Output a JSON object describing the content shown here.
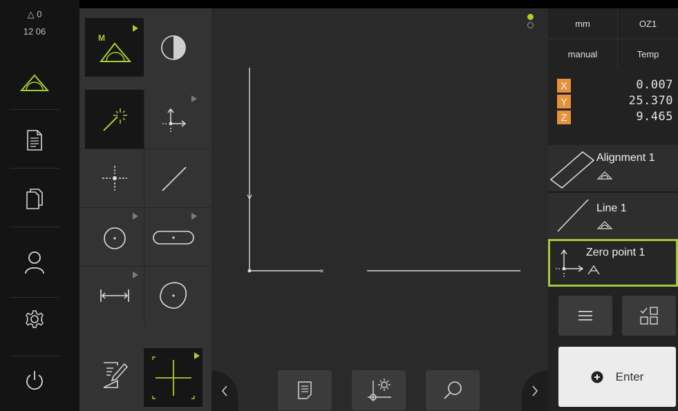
{
  "status": {
    "warnings": "△ 0",
    "time": "12 06"
  },
  "nav": {
    "items": [
      {
        "name": "measure-icon"
      },
      {
        "name": "measurement-report-icon"
      },
      {
        "name": "file-management-icon"
      },
      {
        "name": "user-login-icon"
      },
      {
        "name": "settings-icon"
      },
      {
        "name": "power-icon"
      }
    ]
  },
  "palette": {
    "tools": [
      "manual-measurement-icon",
      "contrast-icon",
      "measure-magic-icon",
      "zero-point-icon",
      "point-icon",
      "line-icon",
      "circle-icon",
      "slot-icon",
      "distance-icon",
      "blob-icon",
      "annotation-icon",
      "crosshair-icon"
    ]
  },
  "canvas": {
    "buttons": [
      "report-icon",
      "view-settings-icon",
      "zoom-icon"
    ],
    "x_axis_marker": "×"
  },
  "right": {
    "unit": "mm",
    "coord_system": "OZ1",
    "mode": "manual",
    "temp": "Temp",
    "coordinates": [
      {
        "axis": "X",
        "value": "0.007"
      },
      {
        "axis": "Y",
        "value": "25.370"
      },
      {
        "axis": "Z",
        "value": "9.465"
      }
    ],
    "features": [
      {
        "name": "Alignment 1"
      },
      {
        "name": "Line 1"
      },
      {
        "name": "Zero point 1"
      }
    ],
    "enter_label": "Enter"
  },
  "colors": {
    "accent": "#a8cf2a",
    "axis_badge": "#e8903a",
    "selected_border": "#a5c93a"
  }
}
